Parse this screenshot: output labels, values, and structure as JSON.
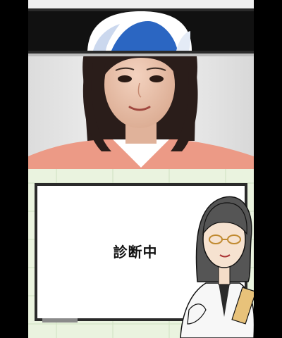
{
  "game": {
    "status_text": "診断中"
  },
  "icons": {
    "scan_overlay": "scan-band-icon",
    "camera_feed": "camera-photo",
    "teacher": "teacher-character"
  },
  "colors": {
    "screen_bg": "#000000",
    "board_frame": "#222222",
    "board_fill": "#ffffff",
    "grid_bg": "#eaf3df",
    "scan_blue": "#2b66c2"
  }
}
